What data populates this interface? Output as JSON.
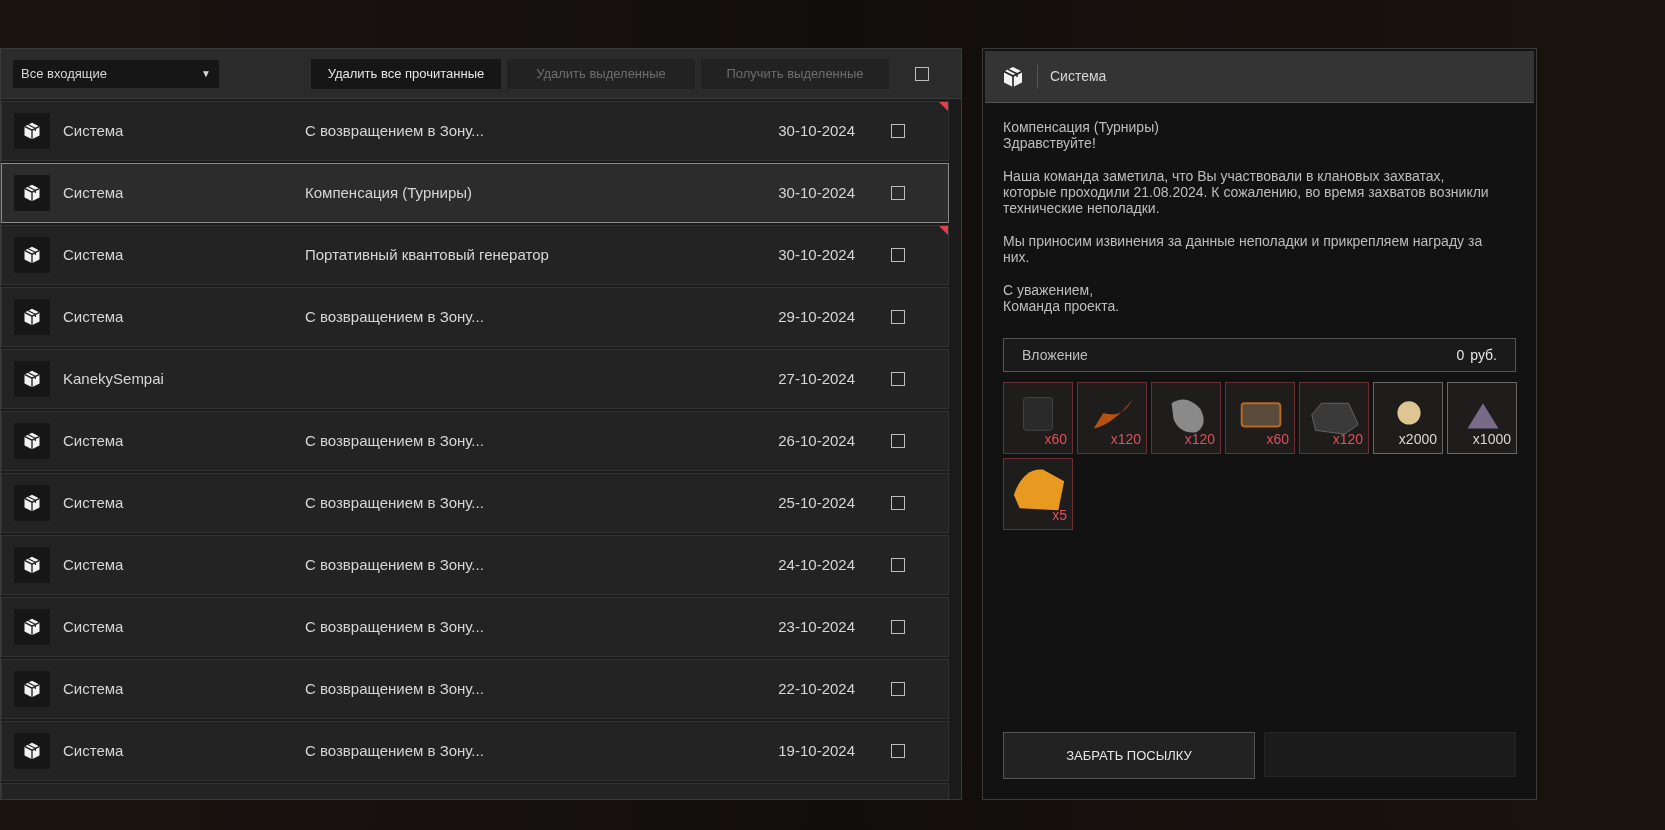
{
  "toolbar": {
    "filter": {
      "value": "Все входящие",
      "caret": "▼"
    },
    "buttons": [
      {
        "label": "Удалить все прочитанные",
        "disabled": false
      },
      {
        "label": "Удалить выделенные",
        "disabled": true
      },
      {
        "label": "Получить выделенные",
        "disabled": true
      }
    ],
    "select_all": {
      "checked": false
    }
  },
  "messages": [
    {
      "sender": "Система",
      "subject": "С возвращением в Зону...",
      "date": "30-10-2024",
      "unread": true,
      "selected": false,
      "checked": false
    },
    {
      "sender": "Система",
      "subject": "Компенсация (Турниры)",
      "date": "30-10-2024",
      "unread": false,
      "selected": true,
      "checked": false
    },
    {
      "sender": "Система",
      "subject": "Портативный квантовый генератор",
      "date": "30-10-2024",
      "unread": true,
      "selected": false,
      "checked": false
    },
    {
      "sender": "Система",
      "subject": "С возвращением в Зону...",
      "date": "29-10-2024",
      "unread": false,
      "selected": false,
      "checked": false
    },
    {
      "sender": "KanekySempai",
      "date": "27-10-2024",
      "unread": false,
      "selected": false,
      "checked": false
    },
    {
      "sender": "Система",
      "subject": "С возвращением в Зону...",
      "date": "26-10-2024",
      "unread": false,
      "selected": false,
      "checked": false
    },
    {
      "sender": "Система",
      "subject": "С возвращением в Зону...",
      "date": "25-10-2024",
      "unread": false,
      "selected": false,
      "checked": false
    },
    {
      "sender": "Система",
      "subject": "С возвращением в Зону...",
      "date": "24-10-2024",
      "unread": false,
      "selected": false,
      "checked": false
    },
    {
      "sender": "Система",
      "subject": "С возвращением в Зону...",
      "date": "23-10-2024",
      "unread": false,
      "selected": false,
      "checked": false
    },
    {
      "sender": "Система",
      "subject": "С возвращением в Зону...",
      "date": "22-10-2024",
      "unread": false,
      "selected": false,
      "checked": false
    },
    {
      "sender": "Система",
      "subject": "С возвращением в Зону...",
      "date": "19-10-2024",
      "unread": false,
      "selected": false,
      "checked": false
    }
  ],
  "detail": {
    "sender": "Система",
    "paragraphs": [
      [
        "Компенсация (Турниры)",
        "Здравствуйте!"
      ],
      [
        "Наша команда заметила, что Вы участвовали в клановых захватах, которые проходили 21.08.2024. К сожалению, во время захватов возникли технические неполадки."
      ],
      [
        "Мы приносим извинения за данные неполадки и прикрепляем награду за них."
      ],
      [
        "С уважением,",
        "Команда проекта."
      ]
    ],
    "attachment": {
      "label": "Вложение",
      "amount": "0",
      "currency": "руб."
    },
    "items": [
      {
        "count": "x60",
        "color": "#e0505a"
      },
      {
        "count": "x120",
        "color": "#e0505a"
      },
      {
        "count": "x120",
        "color": "#e0505a"
      },
      {
        "count": "x60",
        "color": "#e0505a"
      },
      {
        "count": "x120",
        "color": "#e0505a"
      },
      {
        "count": "x2000",
        "color": "#d8d8d8"
      },
      {
        "count": "x1000",
        "color": "#d8d8d8"
      },
      {
        "count": "x5",
        "color": "#e0505a"
      }
    ],
    "action": "ЗАБРАТЬ ПОСЫЛКУ"
  }
}
